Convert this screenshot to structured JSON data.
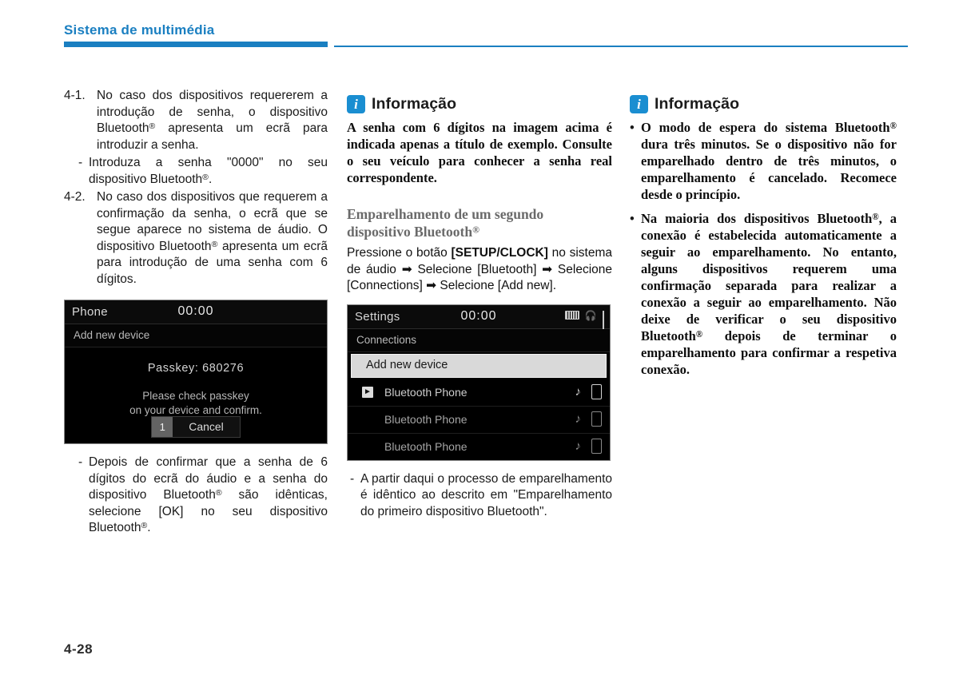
{
  "header": {
    "title": "Sistema de multimédia",
    "accent_color": "#1a7fc1"
  },
  "footer": {
    "page_number": "4-28"
  },
  "column1": {
    "item_4_1": {
      "number": "4-1.",
      "text_before_reg": "No caso dos dispositivos requererem a introdução de senha, o dispositivo Bluetooth®  apresenta um ecrã para introduzir a senha."
    },
    "dash_1": {
      "marker": "-",
      "text": "Introduza a senha \"0000\" no seu dispositivo Bluetooth®."
    },
    "item_4_2": {
      "number": "4-2.",
      "text": "No caso dos dispositivos que requerem a confirmação da senha, o ecrã que se segue aparece no sistema de áudio. O dispositivo Bluetooth® apresenta um ecrã para introdução de uma senha com 6 dígitos."
    },
    "phone_screenshot": {
      "app_title": "Phone",
      "clock": "00:00",
      "sub_label": "Add new device",
      "passkey_label": "Passkey: 680276",
      "message_line1": "Please check passkey",
      "message_line2": "on your device and confirm.",
      "button_badge": "1",
      "button_label": "Cancel"
    },
    "dash_2": {
      "marker": "-",
      "text": "Depois de confirmar que a senha de 6 dígitos do ecrã do áudio e a senha do dispositivo Bluetooth® são idênticas, selecione [OK] no seu dispositivo Bluetooth®."
    }
  },
  "column2": {
    "info": {
      "icon": "info-icon",
      "icon_glyph": "i",
      "title": "Informação",
      "body": "A senha com 6 dígitos na imagem acima é indicada apenas a título de exemplo. Consulte o seu veículo para conhecer a senha real correspondente."
    },
    "sub_heading_line1": "Emparelhamento de um segundo",
    "sub_heading_line2": "dispositivo Bluetooth®",
    "instruction": {
      "part1": "Pressione o botão ",
      "bold1": "[SETUP/CLOCK]",
      "part2": " no sistema de áudio ",
      "arrow1": "➡",
      "part3": " Selecione [Bluetooth] ",
      "arrow2": "➡",
      "part4": " Selecione [Connections] ",
      "arrow3": "➡",
      "part5": " Selecione [Add new]."
    },
    "settings_screenshot": {
      "app_title": "Settings",
      "clock": "00:00",
      "status_icons": [
        "battery-icon",
        "bluetooth-headset-icon",
        "signal-icon"
      ],
      "sub_label": "Connections",
      "rows": [
        {
          "label": "Add new device",
          "highlighted": true,
          "icon": "",
          "right_icons": []
        },
        {
          "label": "Bluetooth Phone",
          "highlighted": false,
          "icon": "bluetooth-icon",
          "right_icons": [
            "music-note-icon",
            "phone-icon"
          ]
        },
        {
          "label": "Bluetooth Phone",
          "highlighted": false,
          "icon": "",
          "right_icons": [
            "music-note-icon",
            "phone-icon"
          ]
        },
        {
          "label": "Bluetooth Phone",
          "highlighted": false,
          "icon": "",
          "right_icons": [
            "music-note-icon",
            "phone-icon"
          ]
        }
      ],
      "music_note_glyph": "♪"
    },
    "dash_note": {
      "marker": "-",
      "text": "A partir daqui o processo de emparelhamento é idêntico ao descrito em \"Emparelhamento do primeiro dispositivo Bluetooth\"."
    }
  },
  "column3": {
    "info": {
      "icon": "info-icon",
      "icon_glyph": "i",
      "title": "Informação",
      "bullet_marker": "•",
      "bullets": [
        "O modo de espera do sistema Bluetooth® dura três minutos. Se o dispositivo não for emparelhado dentro de três minutos, o emparelhamento é cancelado. Recomece desde o princípio.",
        "Na maioria dos dispositivos Bluetooth®, a conexão é estabelecida automaticamente a seguir ao emparelhamento. No entanto, alguns dispositivos requerem uma confirmação separada para realizar a conexão a seguir ao emparelhamento. Não deixe de verificar o seu dispositivo Bluetooth® depois de terminar o emparelhamento para confirmar a respetiva conexão."
      ]
    }
  }
}
